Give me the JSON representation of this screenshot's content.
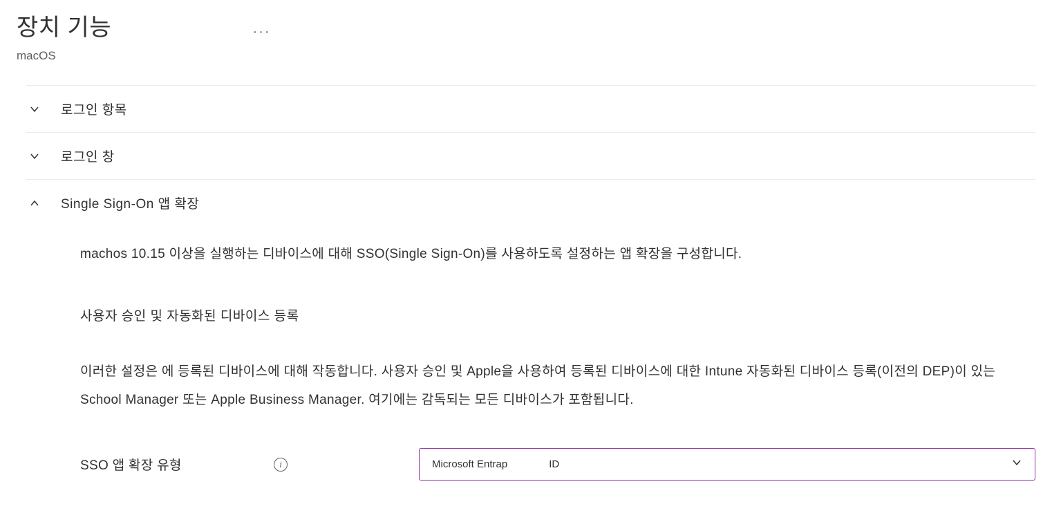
{
  "header": {
    "title": "장치 기능",
    "subtitle": "macOS",
    "more_icon": "more-horizontal-icon"
  },
  "sections": [
    {
      "label": "로그인 항목",
      "expanded": false
    },
    {
      "label": "로그인 창",
      "expanded": false
    },
    {
      "label": "Single Sign-On 앱 확장",
      "expanded": true
    }
  ],
  "sso": {
    "description": "machos  10.15 이상을 실행하는 디바이스에 대해 SSO(Single Sign-On)를 사용하도록 설정하는 앱 확장을 구성합니다.",
    "subheading": "사용자 승인 및 자동화된 디바이스 등록",
    "paragraph": "이러한 설정은 에 등록된 디바이스에 대해 작동합니다.   사용자 승인 및 Apple을 사용하여 등록된 디바이스에 대한 Intune 자동화된 디바이스 등록(이전의 DEP)이 있는 School Manager 또는 Apple Business Manager. 여기에는 감독되는 모든 디바이스가 포함됩니다.",
    "form": {
      "extension_type_label": "SSO 앱 확장 유형",
      "info_icon": "info-icon",
      "dropdown_value_part1": "Microsoft Entrap",
      "dropdown_value_part2": "ID"
    }
  }
}
